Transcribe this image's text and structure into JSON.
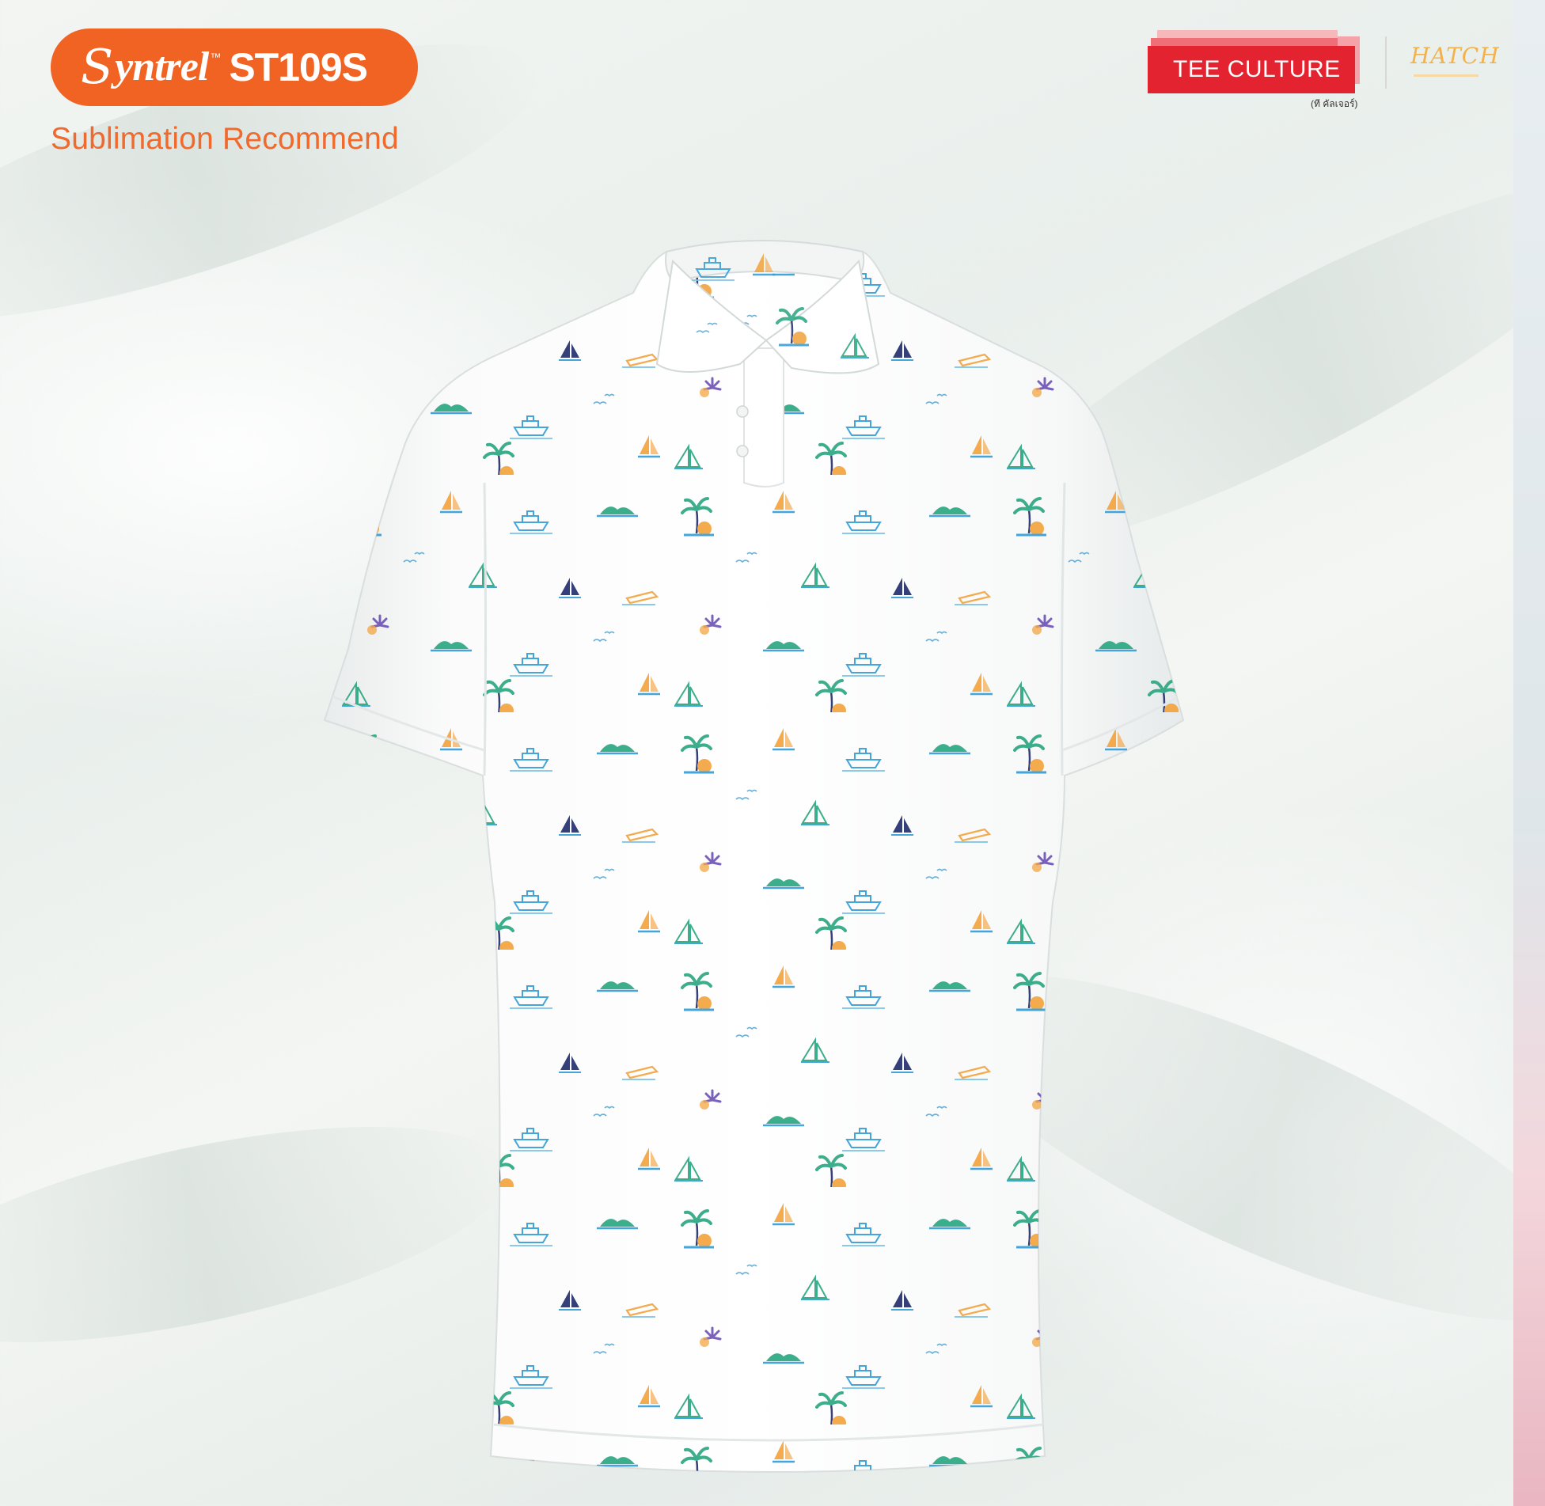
{
  "brand": {
    "initial": "S",
    "name": "yntrel",
    "trademark": "™",
    "model": "ST109S",
    "subtitle": "Sublimation Recommend",
    "badge_color": "#f06322"
  },
  "partner_logo": {
    "text": "TEE CULTURE",
    "thai_caption": "(ที คัลเจอร์)",
    "color": "#e32430"
  },
  "secondary_logo": {
    "text": "HATCH",
    "color": "#f2b14a"
  },
  "product": {
    "item": "polo-shirt",
    "base_color": "#ffffff",
    "pattern_colors": [
      "#2f9bd6",
      "#26a57f",
      "#f2a23a",
      "#6b4fb5",
      "#1f2a6b"
    ]
  }
}
